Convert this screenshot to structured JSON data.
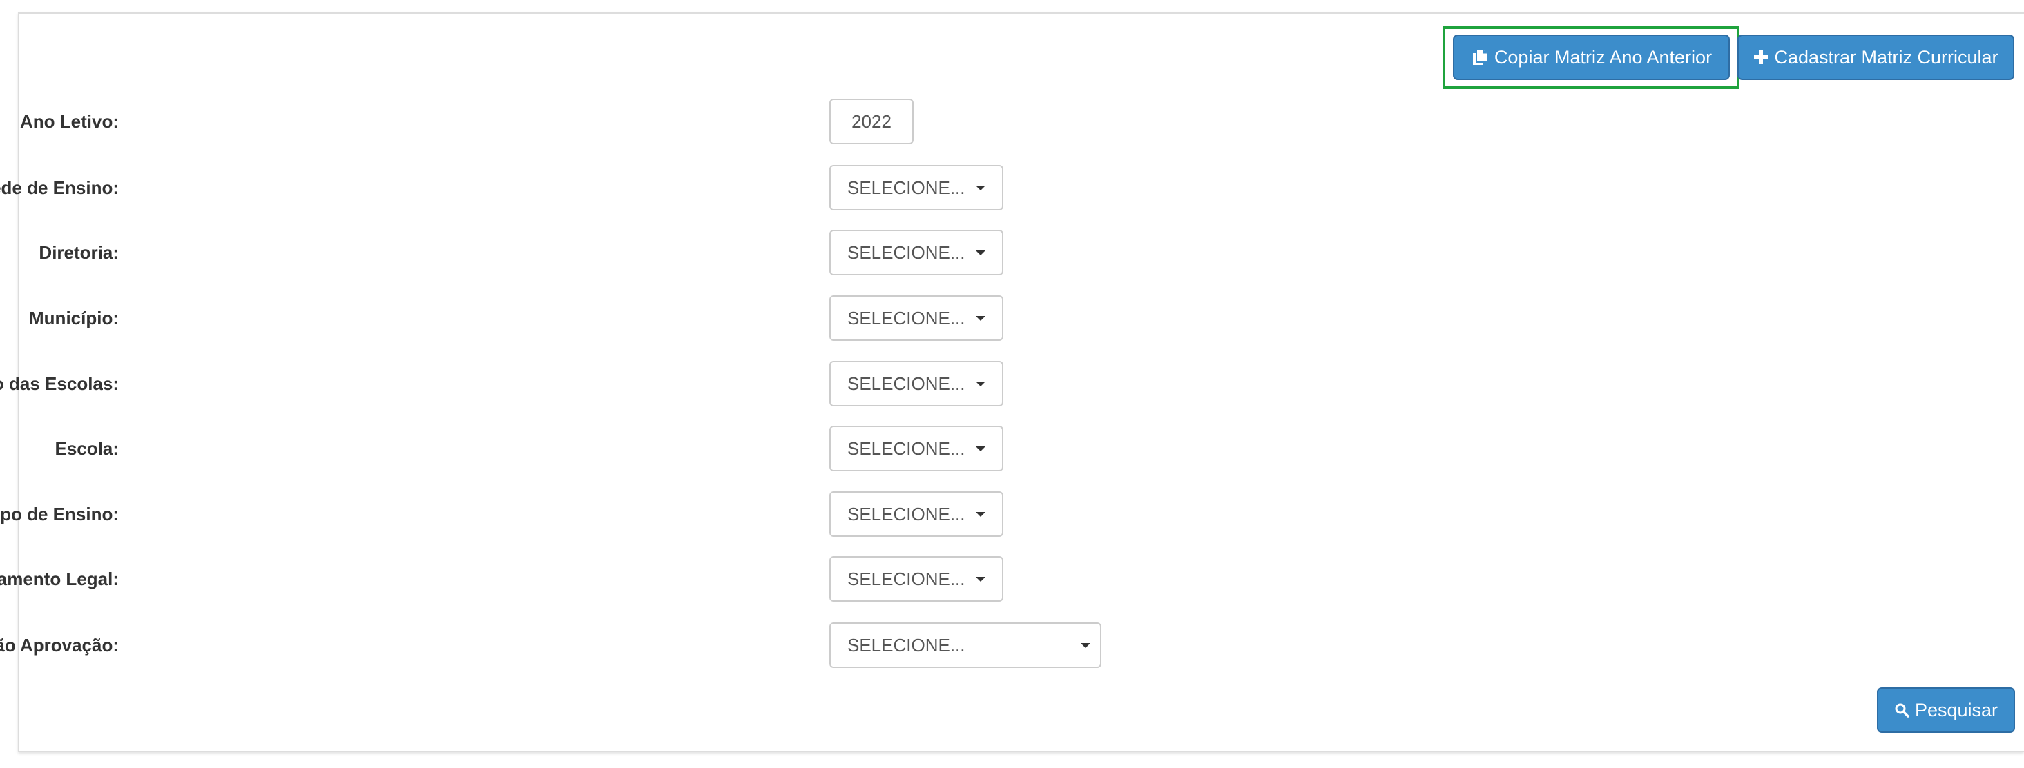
{
  "toolbar": {
    "copy_label": "Copiar Matriz Ano Anterior",
    "add_label": "Cadastrar Matriz Curricular",
    "copy_icon": "copy-icon",
    "add_icon": "plus-icon"
  },
  "form": {
    "ano_letivo": {
      "label": "Ano Letivo:",
      "value": "2022"
    },
    "rede_ensino": {
      "label": "Rede de Ensino:",
      "value": "SELECIONE..."
    },
    "diretoria": {
      "label": "Diretoria:",
      "value": "SELECIONE..."
    },
    "municipio": {
      "label": "Município:",
      "value": "SELECIONE..."
    },
    "situacao_escolas": {
      "label": "Situação das Escolas:",
      "value": "SELECIONE..."
    },
    "escola": {
      "label": "Escola:",
      "value": "SELECIONE..."
    },
    "tipo_ensino": {
      "label": "Tipo de Ensino:",
      "value": "SELECIONE..."
    },
    "fundamento_legal": {
      "label": "Fundamento Legal:",
      "value": "SELECIONE..."
    },
    "situacao_aprovacao": {
      "label": "Situação Aprovação:",
      "value": "SELECIONE..."
    }
  },
  "footer": {
    "search_label": "Pesquisar",
    "search_icon": "search-icon"
  },
  "colors": {
    "primary": "#3c8dcb",
    "primary_border": "#2e6da4",
    "highlight": "#1fa33d"
  }
}
